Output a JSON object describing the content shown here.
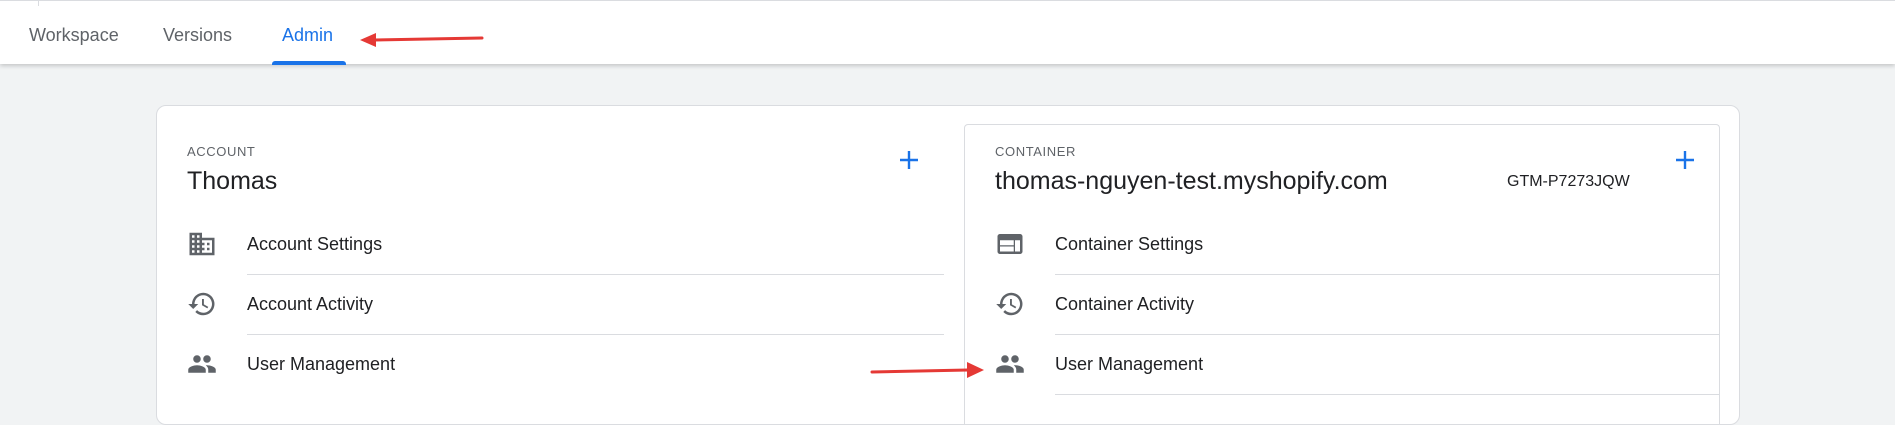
{
  "nav": {
    "tabs": [
      {
        "label": "Workspace"
      },
      {
        "label": "Versions"
      },
      {
        "label": "Admin"
      }
    ],
    "active_tab": "Admin"
  },
  "account": {
    "section_label": "ACCOUNT",
    "name": "Thomas",
    "add_icon": "plus-icon",
    "items": [
      {
        "label": "Account Settings",
        "icon": "building-icon"
      },
      {
        "label": "Account Activity",
        "icon": "history-icon"
      },
      {
        "label": "User Management",
        "icon": "people-icon"
      }
    ]
  },
  "container": {
    "section_label": "CONTAINER",
    "name": "thomas-nguyen-test.myshopify.com",
    "id": "GTM-P7273JQW",
    "add_icon": "plus-icon",
    "items": [
      {
        "label": "Container Settings",
        "icon": "web-icon"
      },
      {
        "label": "Container Activity",
        "icon": "history-icon"
      },
      {
        "label": "User Management",
        "icon": "people-icon"
      }
    ]
  },
  "annotations": {
    "arrow_color": "#e53935"
  },
  "colors": {
    "accent": "#1a73e8",
    "text": "#202124",
    "muted": "#5f6368",
    "background": "#f1f3f4"
  }
}
